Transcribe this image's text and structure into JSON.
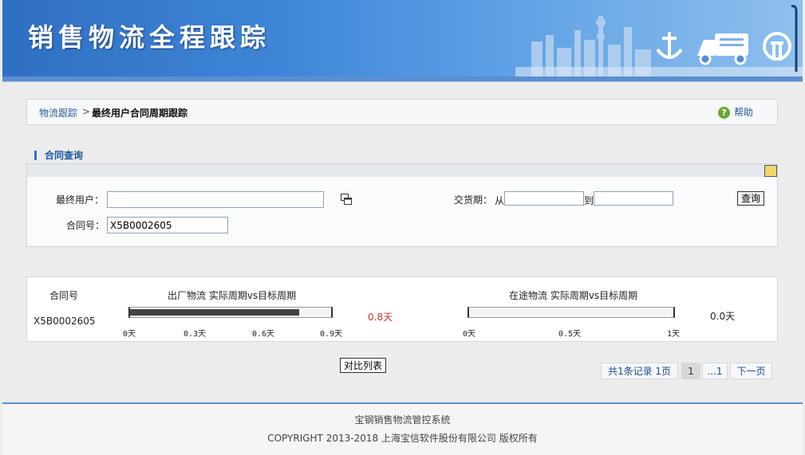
{
  "header": {
    "title": "销售物流全程跟踪"
  },
  "breadcrumb": {
    "link": "物流跟踪",
    "separator": ">",
    "current": "最终用户合同周期跟踪",
    "help": "帮助"
  },
  "query": {
    "section_title": "合同查询",
    "end_user_label": "最终用户：",
    "end_user_value": "",
    "contract_label": "合同号：",
    "contract_value": "X5B0002605",
    "delivery_label": "交货期：",
    "from_label": "从",
    "to_label": "到",
    "from_value": "",
    "to_value": "",
    "query_button": "查询"
  },
  "results": {
    "col_contract": "合同号",
    "col_factory": "出厂物流  实际周期vs目标周期",
    "col_transit": "在途物流  实际周期vs目标周期",
    "rows": [
      {
        "contract": "X5B0002605",
        "factory_days": "0.8天",
        "factory_fraction": 0.84,
        "factory_ticks": [
          "0天",
          "0.3天",
          "0.6天",
          "0.9天"
        ],
        "transit_days": "0.0天",
        "transit_fraction": 0.0,
        "transit_ticks": [
          "0天",
          "0.5天",
          "1天"
        ]
      }
    ]
  },
  "compare_button": "对比列表",
  "pagination": {
    "summary": "共1条记录  1页",
    "current": "1",
    "ellipsis": "...1",
    "next": "下一页"
  },
  "footer": {
    "line1": "宝钢销售物流管控系统",
    "line2": "COPYRIGHT 2013-2018 上海宝信软件股份有限公司  版权所有"
  },
  "colors": {
    "header_blue": "#3f86d8",
    "accent": "#2d72c8",
    "days_red": "#c0392b",
    "help_green": "#6aa832"
  },
  "icons": {
    "help": "help-icon",
    "edit": "edit-icon",
    "picker": "picker-icon",
    "anchor": "anchor-icon",
    "truck": "truck-icon",
    "rail": "rail-icon"
  }
}
